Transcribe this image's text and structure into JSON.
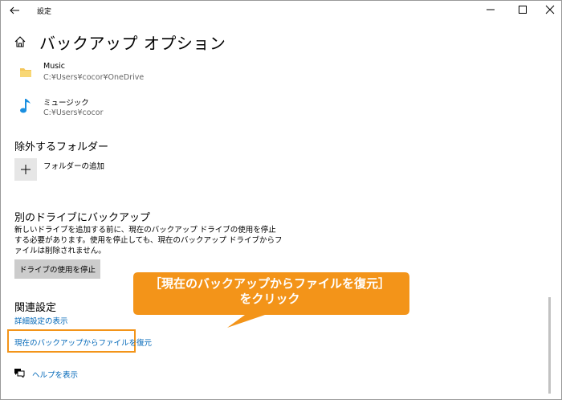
{
  "window": {
    "title": "設定"
  },
  "page": {
    "title": "バックアップ オプション"
  },
  "folders": [
    {
      "name": "Music",
      "path": "C:¥Users¥cocor¥OneDrive",
      "icon": "folder-icon"
    },
    {
      "name": "ミュージック",
      "path": "C:¥Users¥cocor",
      "icon": "music-note-icon"
    }
  ],
  "exclude": {
    "heading": "除外するフォルダー",
    "add_label": "フォルダーの追加"
  },
  "other_drive": {
    "heading": "別のドライブにバックアップ",
    "description": "新しいドライブを追加する前に、現在のバックアップ ドライブの使用を停止する必要があります。使用を停止しても、現在のバックアップ ドライブからファイルは削除されません。",
    "stop_button": "ドライブの使用を停止"
  },
  "related": {
    "heading": "関連設定",
    "advanced_link": "詳細設定の表示",
    "restore_link": "現在のバックアップからファイルを復元"
  },
  "help": {
    "label": "ヘルプを表示"
  },
  "annotation": {
    "line1": "［現在のバックアップからファイルを復元］",
    "line2": "をクリック"
  },
  "colors": {
    "accent": "#0067b8",
    "callout": "#f39419",
    "highlight_border": "#f39419"
  }
}
